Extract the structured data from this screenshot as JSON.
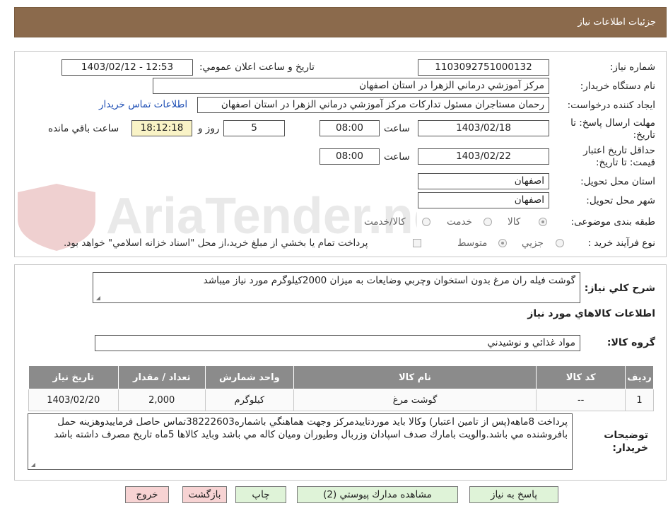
{
  "header": {
    "title": "جزئيات اطلاعات نياز"
  },
  "form": {
    "need_number_label": "شماره نياز:",
    "need_number": "1103092751000132",
    "announce_label": "تاريخ و ساعت اعلان عمومي:",
    "announce_value": "1403/02/12 - 12:53",
    "buyer_org_label": "نام دستگاه خريدار:",
    "buyer_org": "مركز آموزشي درماني الزهرا در استان اصفهان",
    "requester_label": "ايجاد كننده درخواست:",
    "requester": "رحمان مستاجران مسئول تداركات مركز آموزشي درماني الزهرا در استان اصفهان",
    "contact_link": "اطلاعات تماس خريدار",
    "deadline_label_line1": "مهلت ارسال پاسخ: تا",
    "deadline_label_line2": "تاريخ:",
    "deadline_date": "1403/02/18",
    "time_label": "ساعت",
    "deadline_time": "08:00",
    "days_value": "5",
    "days_label": "روز و",
    "remaining_time": "18:12:18",
    "remaining_label": "ساعت باقي مانده",
    "validity_label_line1": "حداقل تاريخ اعتبار",
    "validity_label_line2": "قيمت: تا تاريخ:",
    "validity_date": "1403/02/22",
    "validity_time": "08:00",
    "province_label": "استان محل تحويل:",
    "province": "اصفهان",
    "city_label": "شهر محل تحويل:",
    "city": "اصفهان",
    "category_label": "طبقه بندی موضوعی:",
    "category_options": [
      "كالا",
      "خدمت",
      "كالا/خدمت"
    ],
    "category_selected": "كالا",
    "process_label": "نوع فرآيند خريد :",
    "process_options": [
      "جزيي",
      "متوسط"
    ],
    "process_selected": "متوسط",
    "payment_note": "پرداخت تمام يا بخشي از مبلغ خريد،از محل \"اسناد خزانه اسلامي\" خواهد بود."
  },
  "summary": {
    "label": "شرح كلي نياز:",
    "text": "گوشت فيله ران مرغ بدون استخوان وچربي وضايعات به ميزان 2000كيلوگرم مورد نياز ميباشد",
    "items_title": "اطلاعات كالاهاي مورد نياز",
    "group_label": "گروه كالا:",
    "group_value": "مواد غذائي و نوشيدني"
  },
  "table": {
    "headers": [
      "رديف",
      "كد كالا",
      "نام كالا",
      "واحد شمارش",
      "تعداد / مقدار",
      "تاريخ نياز"
    ],
    "rows": [
      [
        "1",
        "--",
        "گوشت مرغ",
        "كيلوگرم",
        "2,000",
        "1403/02/20"
      ]
    ]
  },
  "notes": {
    "label_line1": "توضيحات",
    "label_line2": "خريدار:",
    "text": "پرداخت 8ماهه(پس از تامين اعتبار)  وكالا بايد موردتاييدمركز وجهت هماهنگي  باشماره38222603تماس حاصل فرماييدوهزينه حمل بافروشنده مي باشد.والويت بامارك صدف اسپادان وزربال وطيوران وميان كاله مي باشد وبايد كالاها 5ماه تاريخ مصرف داشته باشد"
  },
  "buttons": {
    "reply": "پاسخ به نياز",
    "view_docs": "مشاهده مدارك پيوستي (2)",
    "print": "چاپ",
    "back": "بازگشت",
    "exit": "خروج"
  },
  "watermark": {
    "text": "AriaTender.neT"
  }
}
